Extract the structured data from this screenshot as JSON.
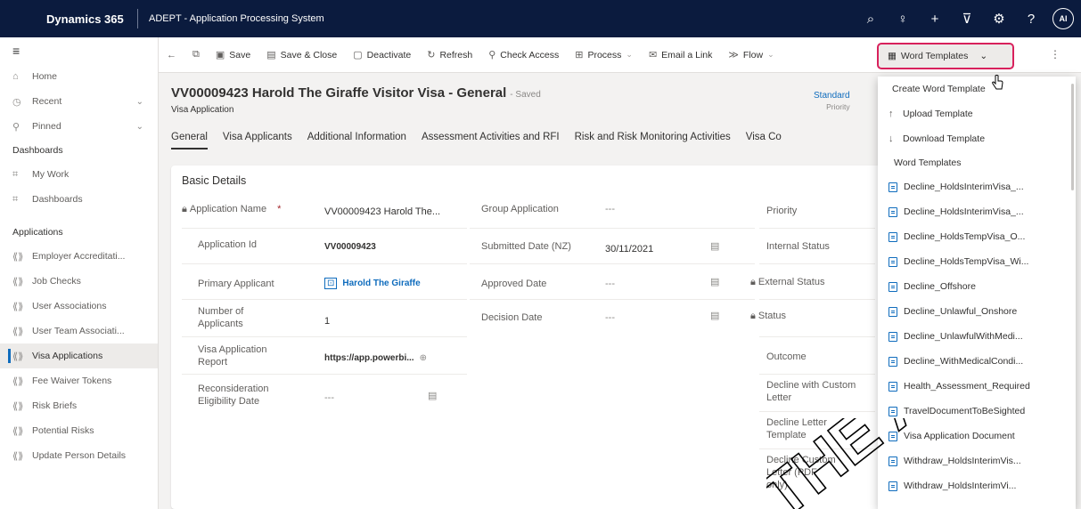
{
  "topbar": {
    "brand": "Dynamics 365",
    "app_title": "ADEPT - Application Processing System",
    "avatar_initials": "AI",
    "icons": [
      "search-icon",
      "lightbulb-icon",
      "plus-icon",
      "filter-icon",
      "gear-icon",
      "help-icon"
    ],
    "icon_glyphs": [
      "⌕",
      "♀",
      "+",
      "⊽",
      "⚙",
      "?"
    ]
  },
  "commands": [
    {
      "label": "",
      "icon": "←",
      "name": "back-button"
    },
    {
      "label": "",
      "icon": "⧉",
      "name": "popout-button"
    },
    {
      "label": "Save",
      "icon": "💾",
      "name": "save-button"
    },
    {
      "label": "Save & Close",
      "icon": "🖫",
      "name": "save-close-button"
    },
    {
      "label": "Deactivate",
      "icon": "🗋",
      "name": "deactivate-button"
    },
    {
      "label": "Refresh",
      "icon": "↻",
      "name": "refresh-button"
    },
    {
      "label": "Check Access",
      "icon": "🔍",
      "name": "check-access-button"
    },
    {
      "label": "Process",
      "icon": "⊞",
      "name": "process-button",
      "dropdown": true
    },
    {
      "label": "Email a Link",
      "icon": "✉",
      "name": "email-link-button"
    },
    {
      "label": "Flow",
      "icon": "≫",
      "name": "flow-button",
      "dropdown": true
    }
  ],
  "word_templates_button": "Word Templates",
  "sidebar": {
    "top": [
      {
        "label": "Home",
        "icon": "⌂"
      },
      {
        "label": "Recent",
        "icon": "◷",
        "chevron": true
      },
      {
        "label": "Pinned",
        "icon": "⚲",
        "chevron": true
      }
    ],
    "dashboards_header": "Dashboards",
    "dashboards": [
      {
        "label": "My Work",
        "icon": "⌗"
      },
      {
        "label": "Dashboards",
        "icon": "⌗"
      }
    ],
    "applications_header": "Applications",
    "applications": [
      {
        "label": "Employer Accreditati...",
        "active": false
      },
      {
        "label": "Job Checks",
        "active": false
      },
      {
        "label": "User Associations",
        "active": false
      },
      {
        "label": "User Team Associati...",
        "active": false
      },
      {
        "label": "Visa Applications",
        "active": true
      },
      {
        "label": "Fee Waiver Tokens",
        "active": false
      },
      {
        "label": "Risk Briefs",
        "active": false
      },
      {
        "label": "Potential Risks",
        "active": false
      },
      {
        "label": "Update Person Details",
        "active": false
      }
    ]
  },
  "record": {
    "title": "VV00009423 Harold The Giraffe Visitor Visa - General",
    "saved": "- Saved",
    "entity": "Visa Application",
    "priority_value": "Standard",
    "priority_label": "Priority"
  },
  "tabs": [
    "General",
    "Visa Applicants",
    "Additional Information",
    "Assessment Activities and RFI",
    "Risk and Risk Monitoring Activities",
    "Visa Co"
  ],
  "basic_details": {
    "title": "Basic Details",
    "col1": [
      {
        "label": "Application Name",
        "value": "VV00009423 Harold The...",
        "locked": true,
        "required": true
      },
      {
        "label": "Application Id",
        "value": "VV00009423"
      },
      {
        "label": "Primary Applicant",
        "value": "Harold The Giraffe",
        "link": true
      },
      {
        "label": "Number of Applicants",
        "value": "1"
      },
      {
        "label": "Visa Application Report",
        "value": "https://app.powerbi..."
      },
      {
        "label": "Reconsideration Eligibility Date",
        "value": "---"
      }
    ],
    "col2": [
      {
        "label": "Group Application",
        "value": "---"
      },
      {
        "label": "Submitted Date (NZ)",
        "value": "30/11/2021"
      },
      {
        "label": "Approved Date",
        "value": "---"
      },
      {
        "label": "Decision Date",
        "value": "---"
      }
    ],
    "col3": [
      {
        "label": "Priority",
        "locked": false
      },
      {
        "label": "Internal Status",
        "locked": false
      },
      {
        "label": "External Status",
        "locked": true
      },
      {
        "label": "Status",
        "locked": true
      },
      {
        "label": "Outcome",
        "locked": false
      },
      {
        "label": "Decline with Custom Letter",
        "locked": false
      },
      {
        "label": "Decline Letter Template",
        "locked": false
      },
      {
        "label": "Decline Custom Letter (PDF only)",
        "locked": false
      }
    ]
  },
  "dropdown": {
    "actions": [
      {
        "label": "Create Word Template",
        "icon": ""
      },
      {
        "label": "Upload Template",
        "icon": "↑"
      },
      {
        "label": "Download Template",
        "icon": "↓"
      }
    ],
    "section": "Word Templates",
    "templates": [
      "Decline_HoldsInterimVisa_...",
      "Decline_HoldsInterimVisa_...",
      "Decline_HoldsTempVisa_O...",
      "Decline_HoldsTempVisa_Wi...",
      "Decline_Offshore",
      "Decline_Unlawful_Onshore",
      "Decline_UnlawfulWithMedi...",
      "Decline_WithMedicalCondi...",
      "Health_Assessment_Required",
      "TravelDocumentToBeSighted",
      "Visa Application Document",
      "Withdraw_HoldsInterimVis...",
      "Withdraw_HoldsInterimVi..."
    ]
  },
  "watermark": "THE ACT",
  "colors": {
    "topbar": "#0b1b3e",
    "accent": "#0f6cbd",
    "highlight": "#d8215c"
  }
}
